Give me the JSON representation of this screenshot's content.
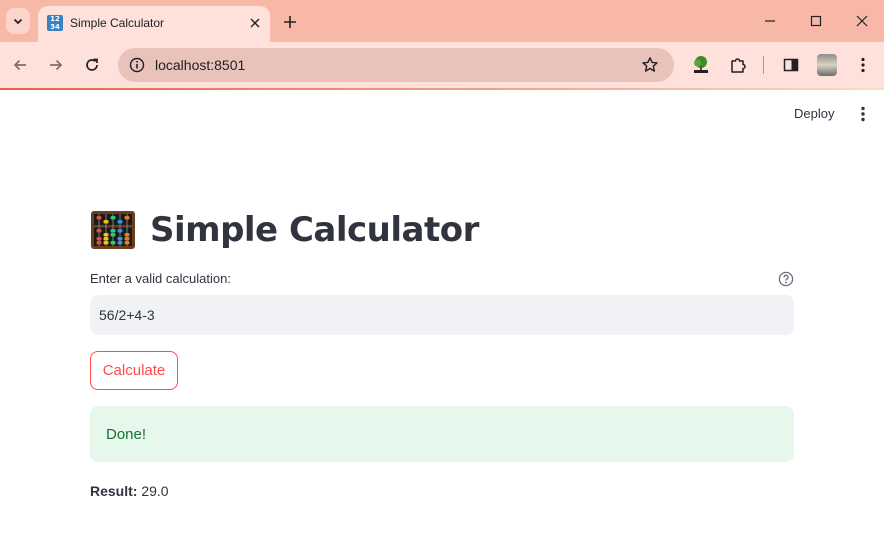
{
  "browser": {
    "tab": {
      "title": "Simple Calculator",
      "favicon_text_top": "12",
      "favicon_text_bottom": "34"
    },
    "omnibox": {
      "url": "localhost:8501"
    },
    "colors": {
      "tabbar": "#f8b8a8",
      "toolbar": "#fde1da",
      "omnibox": "#e9c2ba"
    },
    "icons": [
      "tab-search-icon",
      "close-icon",
      "plus-icon",
      "minimize-icon",
      "maximize-icon",
      "window-close-icon",
      "back-arrow-icon",
      "forward-arrow-icon",
      "reload-icon",
      "site-info-icon",
      "star-icon",
      "tree-extension-icon",
      "puzzle-extensions-icon",
      "side-panel-icon",
      "profile-avatar",
      "kebab-menu-icon"
    ]
  },
  "app": {
    "header": {
      "deploy_label": "Deploy"
    },
    "title": "Simple Calculator",
    "title_icon": "abacus-icon",
    "input": {
      "label": "Enter a valid calculation:",
      "value": "56/2+4-3"
    },
    "button_label": "Calculate",
    "success_message": "Done!",
    "result": {
      "label": "Result:",
      "value": "29.0"
    },
    "colors": {
      "primary": "#ff4b4b",
      "text": "#31333f",
      "input_bg": "#f0f2f6",
      "success_bg": "#e6f7ec",
      "success_text": "#177233"
    }
  }
}
